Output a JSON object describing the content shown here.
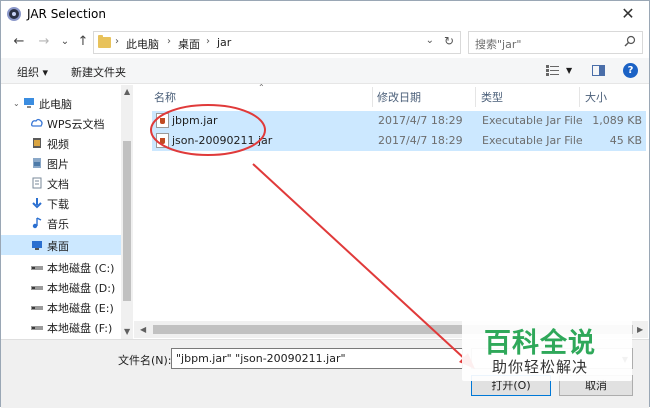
{
  "window": {
    "title": "JAR Selection",
    "close_glyph": "✕"
  },
  "nav": {
    "back_glyph": "←",
    "forward_glyph": "→",
    "recent_glyph": "⌄",
    "up_glyph": "↑",
    "breadcrumb": [
      "此电脑",
      "桌面",
      "jar"
    ],
    "search_placeholder": "搜索\"jar\""
  },
  "toolbar": {
    "organize": "组织 ▾",
    "new_folder": "新建文件夹",
    "help": "?"
  },
  "sidebar": {
    "items": [
      {
        "label": "此电脑",
        "icon": "computer-icon"
      },
      {
        "label": "WPS云文档",
        "icon": "cloud-icon"
      },
      {
        "label": "视频",
        "icon": "video-icon"
      },
      {
        "label": "图片",
        "icon": "pictures-icon"
      },
      {
        "label": "文档",
        "icon": "documents-icon"
      },
      {
        "label": "下载",
        "icon": "download-icon"
      },
      {
        "label": "音乐",
        "icon": "music-icon"
      },
      {
        "label": "桌面",
        "icon": "desktop-icon",
        "selected": true
      },
      {
        "label": "本地磁盘 (C:)",
        "icon": "drive-icon"
      },
      {
        "label": "本地磁盘 (D:)",
        "icon": "drive-icon"
      },
      {
        "label": "本地磁盘 (E:)",
        "icon": "drive-icon"
      },
      {
        "label": "本地磁盘 (F:)",
        "icon": "drive-icon"
      }
    ]
  },
  "columns": [
    "名称",
    "修改日期",
    "类型",
    "大小"
  ],
  "files": [
    {
      "name": "jbpm.jar",
      "modified": "2017/4/7 18:29",
      "type": "Executable Jar File",
      "size": "1,089 KB"
    },
    {
      "name": "json-20090211.jar",
      "modified": "2017/4/7 18:29",
      "type": "Executable Jar File",
      "size": "45 KB"
    }
  ],
  "footer": {
    "filename_label": "文件名(N):",
    "filename_value": "\"jbpm.jar\" \"json-20090211.jar\"",
    "open_button": "打开(O)",
    "cancel_button": "取消"
  },
  "watermark": {
    "line1": "百科全说",
    "line2": "助你轻松解决"
  },
  "colors": {
    "selection": "#cce8ff",
    "annotation": "#e03a3a",
    "watermark_green": "#2fa85a"
  }
}
